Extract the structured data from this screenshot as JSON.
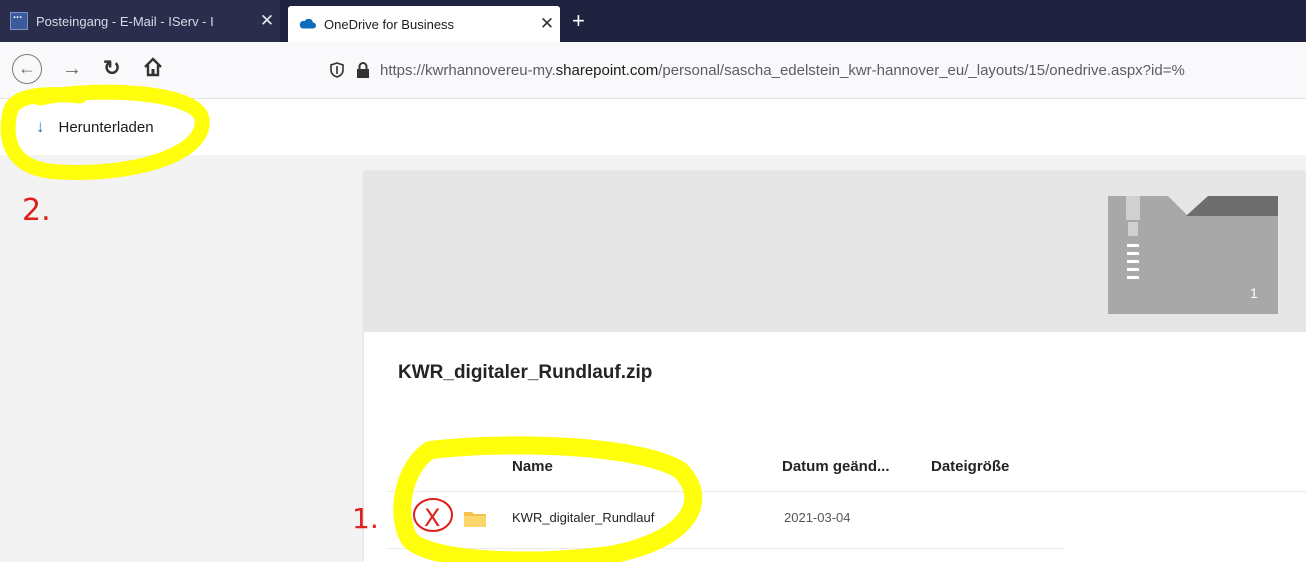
{
  "browser": {
    "tabs": [
      {
        "title": "Posteingang - E-Mail - IServ - I",
        "active": false
      },
      {
        "title": "OneDrive for Business",
        "active": true
      }
    ],
    "close_glyph": "✕",
    "new_tab_glyph": "+",
    "url": {
      "prefix": "https://kwrhannovereu-my.",
      "domain": "sharepoint.com",
      "path": "/personal/sascha_edelstein_kwr-hannover_eu/_layouts/15/onedrive.aspx?id=%"
    }
  },
  "toolbar": {
    "download_label": "Herunterladen",
    "download_icon": "download-arrow-icon"
  },
  "archive": {
    "title": "KWR_digitaler_Rundlauf.zip",
    "item_count": "1",
    "columns": {
      "name": "Name",
      "date": "Datum geänd...",
      "size": "Dateigröße"
    },
    "rows": [
      {
        "name": "KWR_digitaler_Rundlauf",
        "date": "2021-03-04",
        "size": "",
        "type": "folder"
      }
    ]
  },
  "annotations": {
    "step1": "1.",
    "step2": "2.",
    "mark": "X",
    "highlight_color": "#ffff00",
    "ink_color": "#e0201c"
  },
  "colors": {
    "tab_bg": "#202340",
    "accent": "#2a73c8",
    "folder": "#f4c24a"
  }
}
